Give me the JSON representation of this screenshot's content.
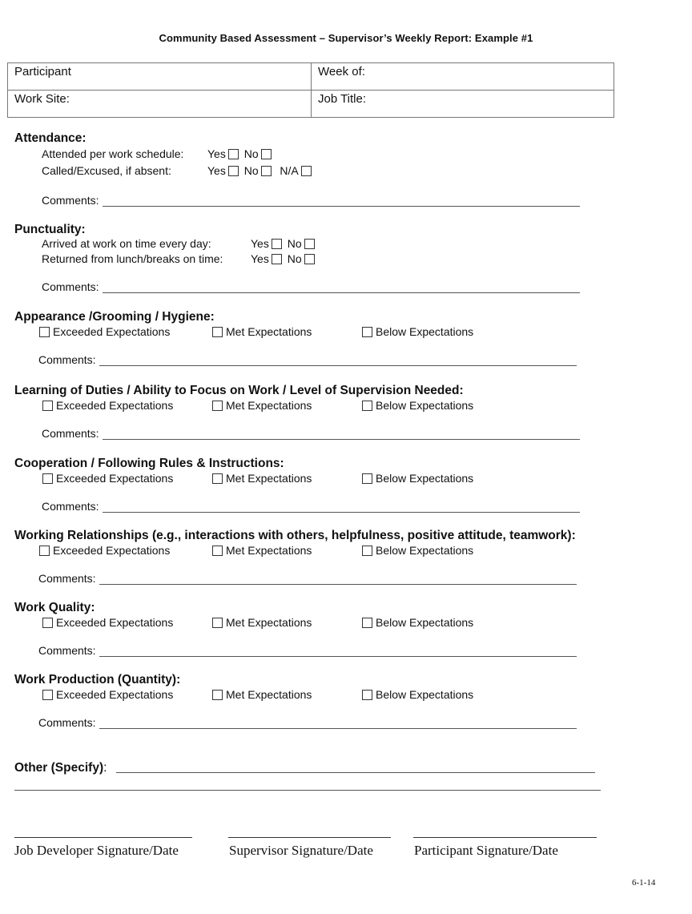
{
  "header": {
    "title": "Community Based Assessment – Supervisor’s Weekly Report:  Example #1"
  },
  "info_table": {
    "participant_label": "Participant",
    "week_label": "Week of:",
    "work_site_label": "Work Site:",
    "job_title_label": "Job Title:"
  },
  "common": {
    "yes": "Yes",
    "no": "No",
    "na": "N/A",
    "comments": "Comments:",
    "exceeded": "Exceeded Expectations",
    "met": "Met Expectations",
    "below": "Below Expectations"
  },
  "attendance": {
    "title": "Attendance:",
    "q1": "Attended per work schedule:",
    "q2": "Called/Excused, if absent:"
  },
  "punctuality": {
    "title": "Punctuality:",
    "q1": "Arrived at work on time every day:",
    "q2": "Returned from lunch/breaks on time:"
  },
  "rated_sections": [
    {
      "title": "Appearance /Grooming / Hygiene:"
    },
    {
      "title": "Learning of Duties / Ability to Focus on Work / Level of Supervision Needed:"
    },
    {
      "title": "Cooperation / Following Rules & Instructions:"
    },
    {
      "title": "Working Relationships (e.g., interactions with others, helpfulness, positive attitude, teamwork):"
    },
    {
      "title": "Work Quality:"
    },
    {
      "title": "Work Production (Quantity):"
    }
  ],
  "other": {
    "title": "Other (Specify)",
    "colon": ":"
  },
  "signatures": {
    "job_developer": "Job Developer Signature/Date",
    "supervisor": "Supervisor Signature/Date",
    "participant": "Participant Signature/Date"
  },
  "footer": {
    "version": "6-1-14"
  }
}
